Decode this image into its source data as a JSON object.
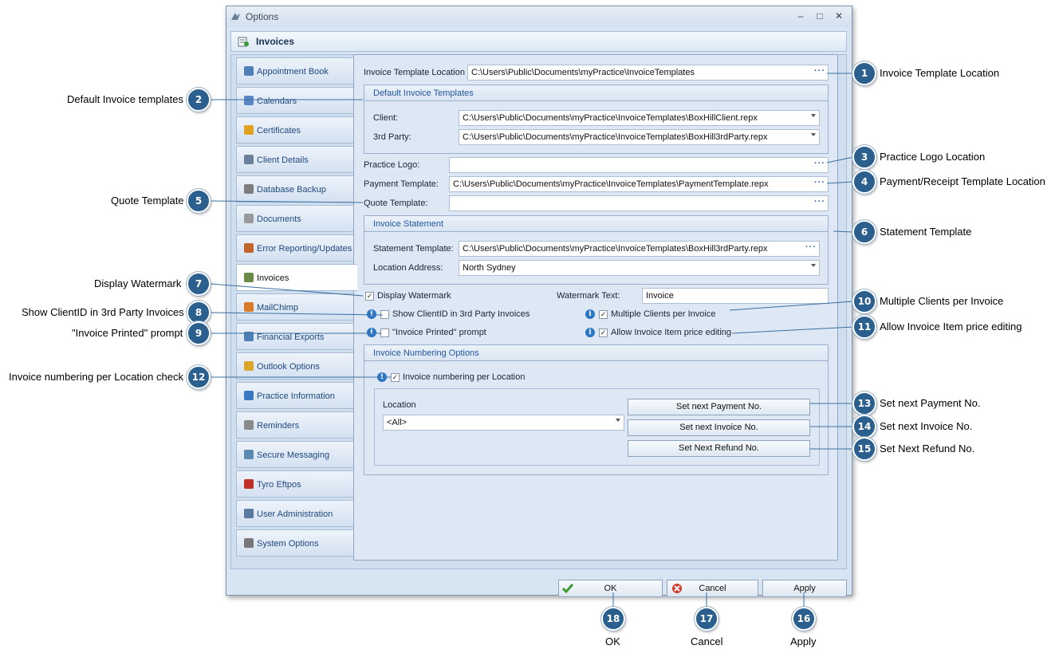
{
  "window": {
    "title": "Options",
    "section_title": "Invoices",
    "controls": {
      "minimize": "–",
      "maximize": "□",
      "close": "✕"
    }
  },
  "nav": {
    "items": [
      {
        "label": "Appointment Book",
        "icon": "calendar-book-icon"
      },
      {
        "label": "Calendars",
        "icon": "calendar-icon"
      },
      {
        "label": "Certificates",
        "icon": "ribbon-icon"
      },
      {
        "label": "Client Details",
        "icon": "people-icon"
      },
      {
        "label": "Database Backup",
        "icon": "backup-icon"
      },
      {
        "label": "Documents",
        "icon": "document-icon"
      },
      {
        "label": "Error Reporting/Updates",
        "icon": "error-report-icon"
      },
      {
        "label": "Invoices",
        "icon": "invoice-icon",
        "active": true
      },
      {
        "label": "MailChimp",
        "icon": "mailchimp-icon"
      },
      {
        "label": "Financial Exports",
        "icon": "export-icon"
      },
      {
        "label": "Outlook Options",
        "icon": "outlook-icon"
      },
      {
        "label": "Practice Information",
        "icon": "practice-icon"
      },
      {
        "label": "Reminders",
        "icon": "clock-icon"
      },
      {
        "label": "Secure Messaging",
        "icon": "secure-message-icon"
      },
      {
        "label": "Tyro Eftpos",
        "icon": "tyro-icon"
      },
      {
        "label": "User Administration",
        "icon": "user-admin-icon"
      },
      {
        "label": "System Options",
        "icon": "gear-icon"
      }
    ]
  },
  "form": {
    "invoice_template_location": {
      "label": "Invoice Template Location",
      "value": "C:\\Users\\Public\\Documents\\myPractice\\InvoiceTemplates",
      "button": "···"
    },
    "default_templates": {
      "title": "Default Invoice Templates",
      "client_label": "Client:",
      "client_value": "C:\\Users\\Public\\Documents\\myPractice\\InvoiceTemplates\\BoxHillClient.repx",
      "third_party_label": "3rd Party:",
      "third_party_value": "C:\\Users\\Public\\Documents\\myPractice\\InvoiceTemplates\\BoxHill3rdParty.repx"
    },
    "practice_logo": {
      "label": "Practice Logo:",
      "value": "",
      "button": "···"
    },
    "payment_template": {
      "label": "Payment Template:",
      "value": "C:\\Users\\Public\\Documents\\myPractice\\InvoiceTemplates\\PaymentTemplate.repx",
      "button": "···"
    },
    "quote_template": {
      "label": "Quote Template:",
      "value": "",
      "button": "···"
    },
    "invoice_statement": {
      "title": "Invoice Statement",
      "statement_label": "Statement Template:",
      "statement_value": "C:\\Users\\Public\\Documents\\myPractice\\InvoiceTemplates\\BoxHill3rdParty.repx",
      "statement_button": "···",
      "location_label": "Location Address:",
      "location_value": "North Sydney"
    },
    "display_watermark": {
      "label": "Display Watermark",
      "checked": true
    },
    "watermark_text": {
      "label": "Watermark Text:",
      "value": "Invoice"
    },
    "show_clientid": {
      "label": "Show ClientID in 3rd Party Invoices",
      "checked": false
    },
    "invoice_printed": {
      "label": "\"Invoice Printed\" prompt",
      "checked": false
    },
    "multiple_clients": {
      "label": "Multiple Clients per Invoice",
      "checked": true
    },
    "allow_price_edit": {
      "label": "Allow Invoice Item price editing",
      "checked": true
    },
    "numbering": {
      "title": "Invoice Numbering Options",
      "per_location_label": "Invoice numbering per Location",
      "per_location_checked": true,
      "location_label": "Location",
      "location_value": "<All>",
      "btn_payment": "Set next Payment No.",
      "btn_invoice": "Set next Invoice No.",
      "btn_refund": "Set Next Refund No."
    },
    "check_mark": "✓",
    "info_glyph": "i"
  },
  "buttons": {
    "ok": "OK",
    "cancel": "Cancel",
    "apply": "Apply"
  },
  "callouts": [
    {
      "n": "1",
      "text": "Invoice Template Location"
    },
    {
      "n": "2",
      "text": "Default Invoice templates"
    },
    {
      "n": "3",
      "text": "Practice Logo Location"
    },
    {
      "n": "4",
      "text": "Payment/Receipt Template Location"
    },
    {
      "n": "5",
      "text": "Quote Template"
    },
    {
      "n": "6",
      "text": "Statement Template"
    },
    {
      "n": "7",
      "text": "Display Watermark"
    },
    {
      "n": "8",
      "text": "Show ClientID in 3rd Party Invoices"
    },
    {
      "n": "9",
      "text": "\"Invoice Printed\" prompt"
    },
    {
      "n": "10",
      "text": "Multiple Clients per Invoice"
    },
    {
      "n": "11",
      "text": "Allow Invoice Item price editing"
    },
    {
      "n": "12",
      "text": "Invoice numbering per Location check"
    },
    {
      "n": "13",
      "text": "Set next Payment No."
    },
    {
      "n": "14",
      "text": "Set next Invoice No."
    },
    {
      "n": "15",
      "text": "Set Next Refund No."
    },
    {
      "n": "16",
      "text": "Apply"
    },
    {
      "n": "17",
      "text": "Cancel"
    },
    {
      "n": "18",
      "text": "OK"
    }
  ],
  "colors": {
    "badge": "#2a5f8e",
    "group_title": "#2455a0",
    "nav_text": "#20497e"
  }
}
